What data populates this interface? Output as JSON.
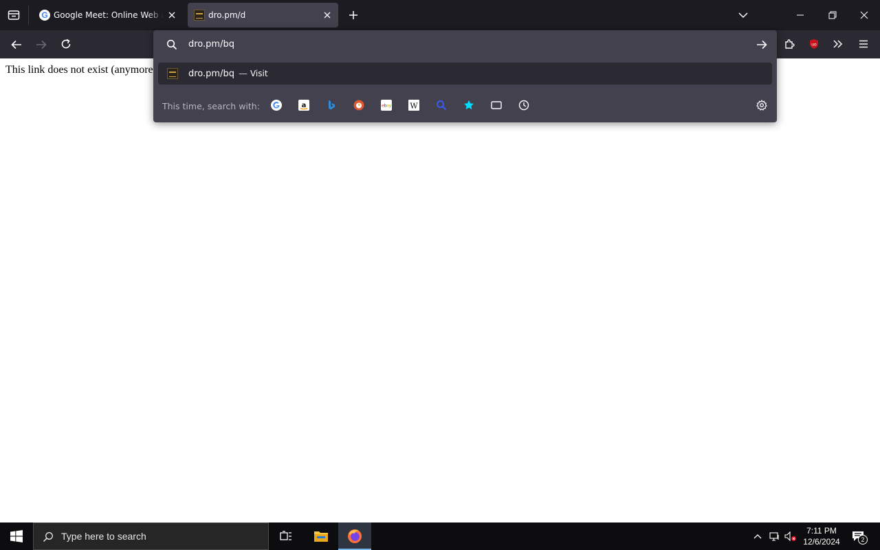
{
  "browser": {
    "tabs": [
      {
        "title": "Google Meet: Online Web and Video Conferencing Calls",
        "favicon": "google-icon",
        "active": false
      },
      {
        "title": "dro.pm/d",
        "favicon": "dro-pm-icon",
        "active": true
      }
    ],
    "address_bar": {
      "value": "dro.pm/bq"
    },
    "suggestion": {
      "url": "dro.pm/bq",
      "separator": "—",
      "action": "Visit"
    },
    "one_off": {
      "label": "This time, search with:",
      "engines": [
        "google-icon",
        "amazon-icon",
        "bing-icon",
        "duckduckgo-icon",
        "ebay-icon",
        "wikipedia-icon",
        "search-icon",
        "bookmarks-star-icon",
        "tabs-icon",
        "history-clock-icon"
      ]
    },
    "accent_color": "#00ddff"
  },
  "page": {
    "body_text": "This link does not exist (anymore)."
  },
  "taskbar": {
    "search_placeholder": "Type here to search",
    "time": "7:11 PM",
    "date": "12/6/2024",
    "notification_count": "2"
  }
}
